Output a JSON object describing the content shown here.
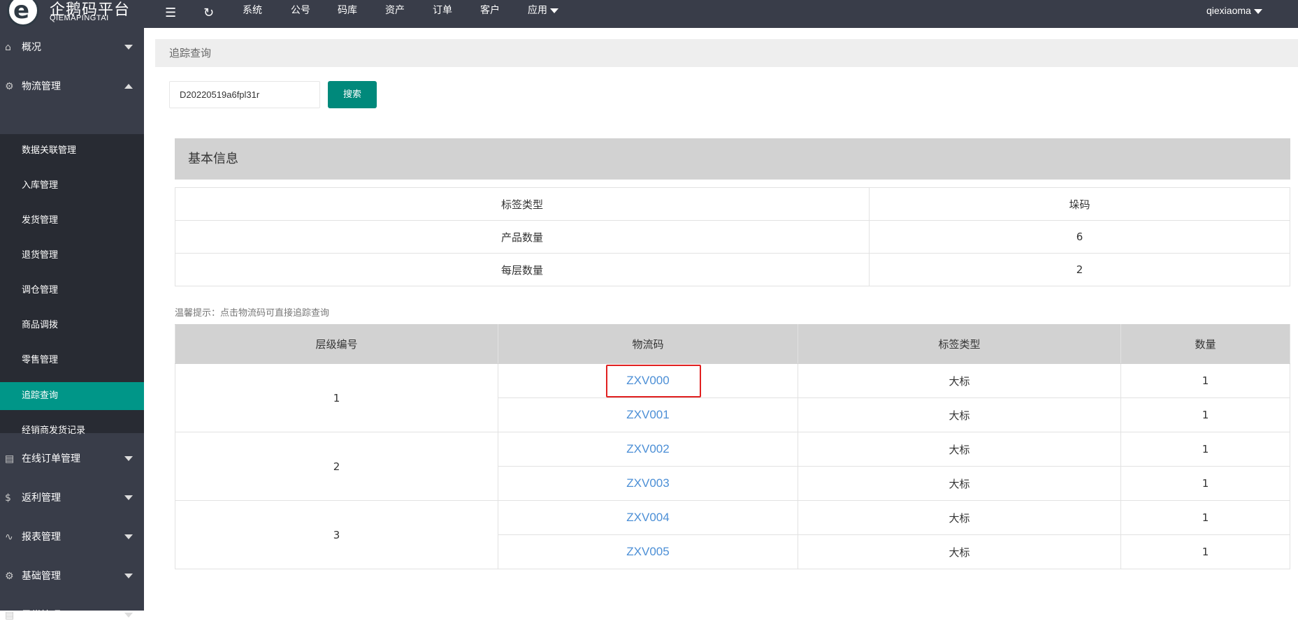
{
  "logo": {
    "cn": "企鹅码平台",
    "en": "QIEMAPINGTAI"
  },
  "topnav": {
    "items": [
      "系统",
      "公号",
      "码库",
      "资产",
      "订单",
      "客户",
      "应用"
    ],
    "user": "qiexiaoma"
  },
  "sidebar": {
    "groups_top": [
      {
        "label": "概况",
        "icon": "home-icon"
      },
      {
        "label": "物流管理",
        "icon": "gear-icon"
      }
    ],
    "sub_items": [
      "数据关联管理",
      "入库管理",
      "发货管理",
      "退货管理",
      "调仓管理",
      "商品调拨",
      "零售管理",
      "追踪查询",
      "经销商发货记录"
    ],
    "active_sub": "追踪查询",
    "groups_bottom": [
      {
        "label": "在线订单管理",
        "icon": "document-icon"
      },
      {
        "label": "返利管理",
        "icon": "dollar-icon"
      },
      {
        "label": "报表管理",
        "icon": "pulse-icon"
      },
      {
        "label": "基础管理",
        "icon": "gear-icon"
      },
      {
        "label": "异常管理",
        "icon": "document-icon"
      }
    ]
  },
  "breadcrumb": "追踪查询",
  "search": {
    "value": "D20220519a6fpl31r",
    "button": "搜索"
  },
  "basic_info": {
    "title": "基本信息",
    "rows": [
      {
        "label": "标签类型",
        "value": "垛码"
      },
      {
        "label": "产品数量",
        "value": "6"
      },
      {
        "label": "每层数量",
        "value": "2"
      }
    ]
  },
  "tip": "温馨提示：点击物流码可直接追踪查询",
  "trace_table": {
    "headers": [
      "层级编号",
      "物流码",
      "标签类型",
      "数量"
    ],
    "levels": [
      "1",
      "2",
      "3"
    ],
    "rows": [
      {
        "code": "ZXV000",
        "type": "大标",
        "qty": "1"
      },
      {
        "code": "ZXV001",
        "type": "大标",
        "qty": "1"
      },
      {
        "code": "ZXV002",
        "type": "大标",
        "qty": "1"
      },
      {
        "code": "ZXV003",
        "type": "大标",
        "qty": "1"
      },
      {
        "code": "ZXV004",
        "type": "大标",
        "qty": "1"
      },
      {
        "code": "ZXV005",
        "type": "大标",
        "qty": "1"
      }
    ]
  },
  "colors": {
    "topbar": "#393d49",
    "active": "#009688",
    "button": "#00897b",
    "link": "#4c8fd6",
    "highlight": "#e12020"
  }
}
